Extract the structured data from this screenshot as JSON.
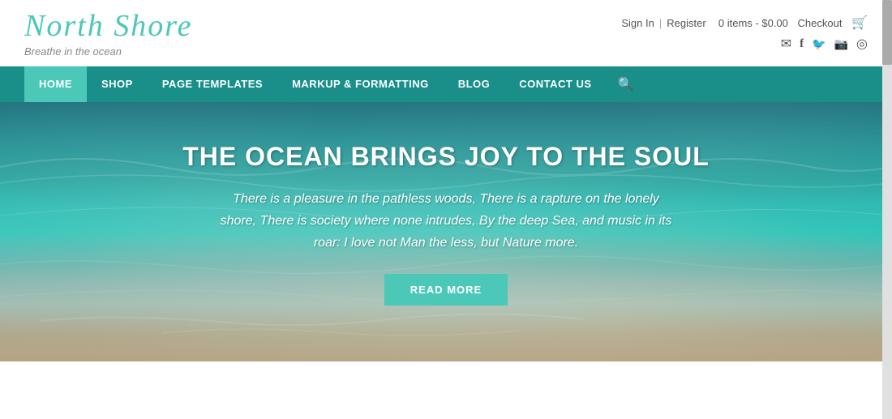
{
  "site": {
    "logo": "North Shore",
    "tagline": "Breathe in the ocean"
  },
  "header": {
    "sign_in": "Sign In",
    "register": "Register",
    "cart": "0 items - $0.00",
    "checkout": "Checkout",
    "cart_icon": "🛒"
  },
  "social": {
    "mail_icon": "✉",
    "facebook_icon": "f",
    "twitter_icon": "🐦",
    "instagram_icon": "📷",
    "tripadvisor_icon": "◎"
  },
  "nav": {
    "items": [
      {
        "label": "HOME",
        "active": true
      },
      {
        "label": "SHOP",
        "active": false
      },
      {
        "label": "PAGE TEMPLATES",
        "active": false
      },
      {
        "label": "MARKUP & FORMATTING",
        "active": false
      },
      {
        "label": "BLOG",
        "active": false
      },
      {
        "label": "CONTACT US",
        "active": false
      }
    ],
    "search_icon": "🔍"
  },
  "hero": {
    "title": "THE OCEAN BRINGS JOY TO THE SOUL",
    "text": "There is a pleasure in the pathless woods, There is a rapture on the lonely shore, There is society where none intrudes, By the deep Sea, and music in its roar: I love not Man the less, but Nature more.",
    "button_label": "READ MORE"
  }
}
